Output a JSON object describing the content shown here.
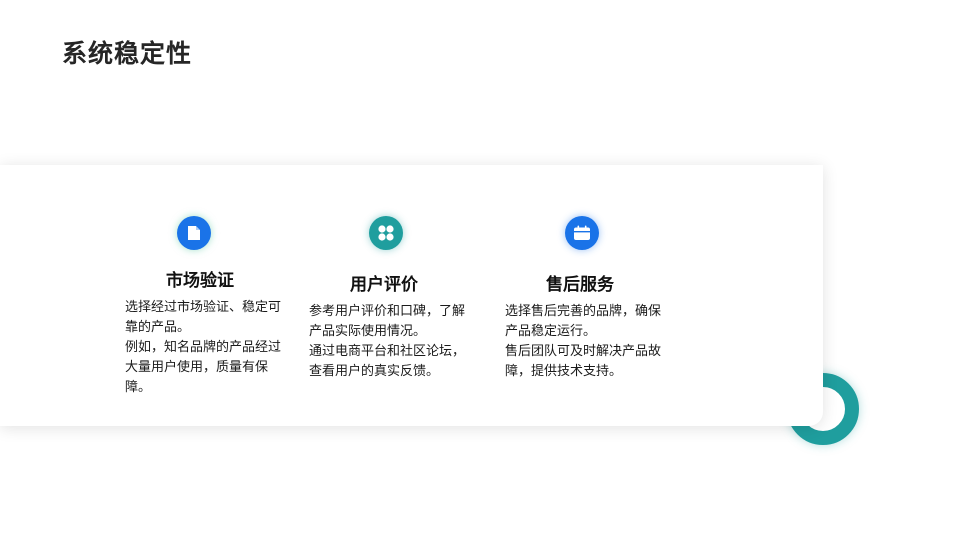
{
  "slide": {
    "title": "系统稳定性"
  },
  "features": [
    {
      "icon": "document-icon",
      "title": "市场验证",
      "desc": [
        "选择经过市场验证、稳定可靠的产品。",
        "例如，知名品牌的产品经过大量用户使用，质量有保障。"
      ]
    },
    {
      "icon": "grid-icon",
      "title": "用户评价",
      "desc": [
        "参考用户评价和口碑，了解产品实际使用情况。",
        "通过电商平台和社区论坛，查看用户的真实反馈。"
      ]
    },
    {
      "icon": "calendar-icon",
      "title": "售后服务",
      "desc": [
        "选择售后完善的品牌，确保产品稳定运行。",
        "售后团队可及时解决产品故障，提供技术支持。"
      ]
    }
  ],
  "colors": {
    "blue": "#1a73e8",
    "teal": "#1f9e9e",
    "title": "#262626"
  }
}
